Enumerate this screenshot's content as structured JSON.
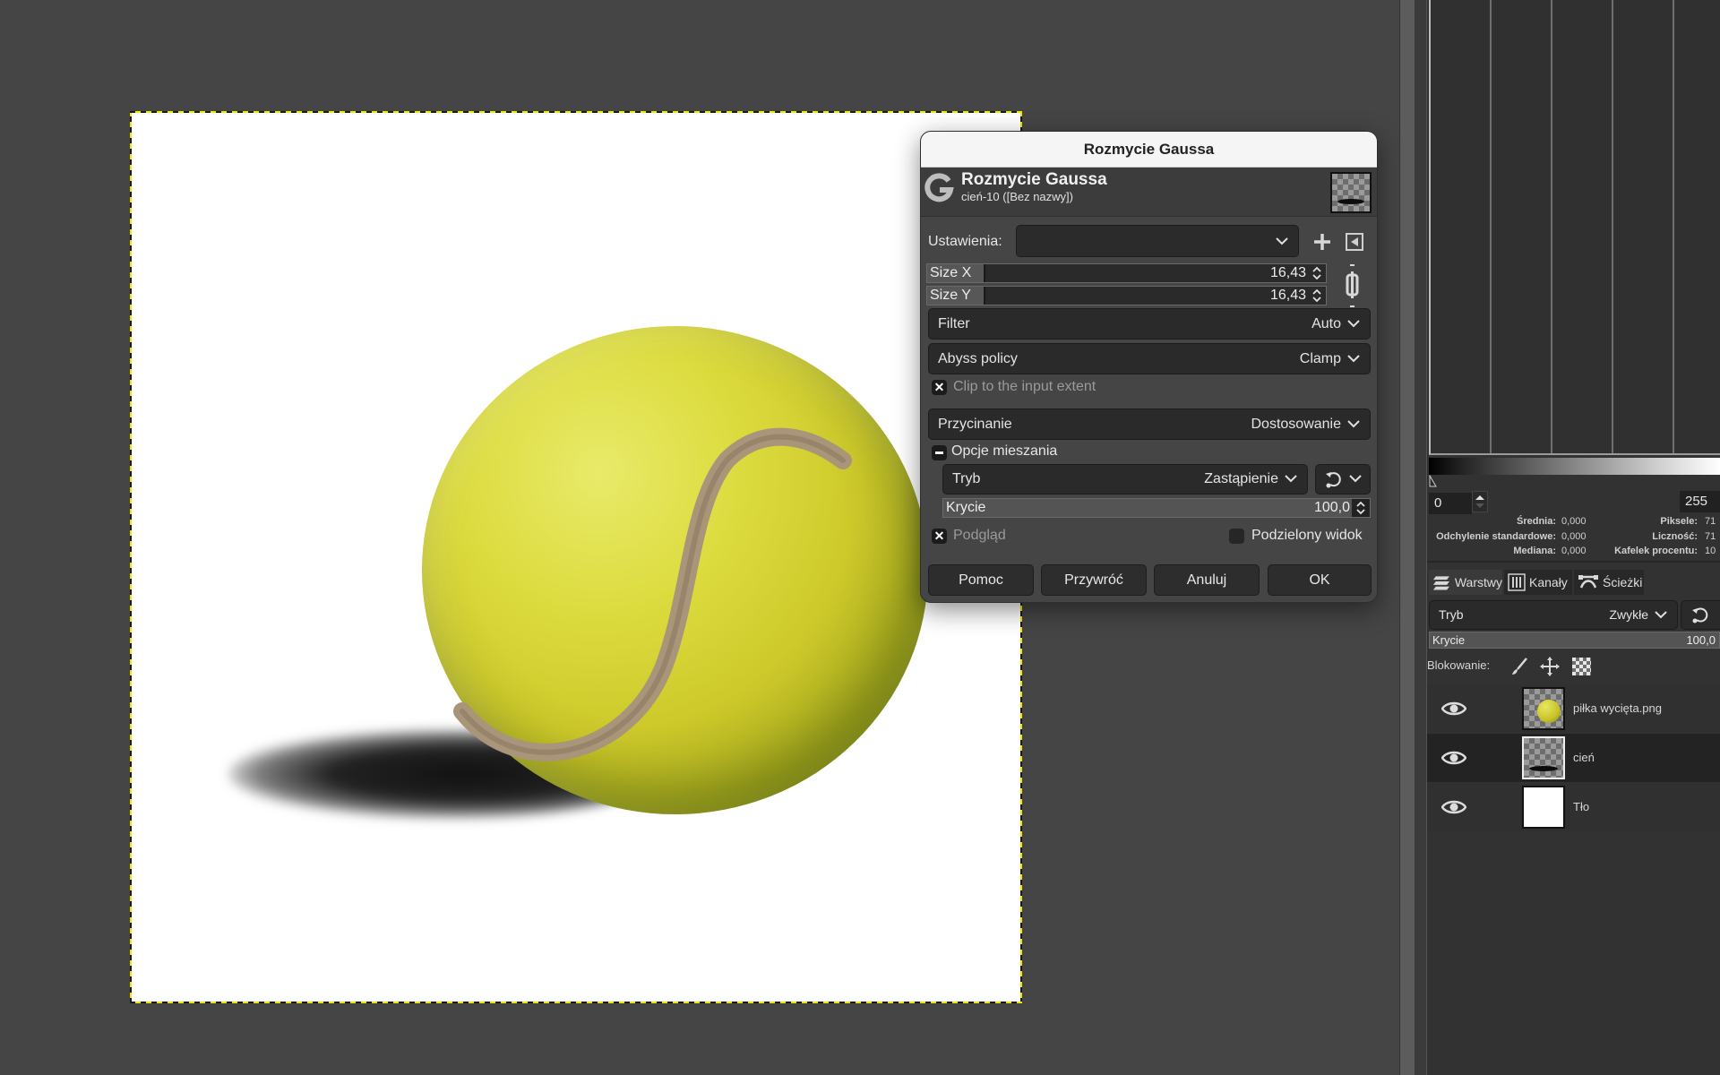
{
  "dialog": {
    "window_title": "Rozmycie Gaussa",
    "header_title": "Rozmycie Gaussa",
    "header_subtitle": "cień-10 ([Bez nazwy])",
    "presets_label": "Ustawienia:",
    "presets_value": "",
    "size_x": {
      "label": "Size X",
      "value": "16,43"
    },
    "size_y": {
      "label": "Size Y",
      "value": "16,43"
    },
    "filter": {
      "label": "Filter",
      "value": "Auto"
    },
    "abyss_policy": {
      "label": "Abyss policy",
      "value": "Clamp"
    },
    "clip_extent": {
      "label": "Clip to the input extent",
      "checked": true
    },
    "clipping": {
      "label": "Przycinanie",
      "value": "Dostosowanie"
    },
    "blending_section": {
      "label": "Opcje mieszania",
      "expanded": true
    },
    "mode": {
      "label": "Tryb",
      "value": "Zastąpienie"
    },
    "opacity": {
      "label": "Krycie",
      "value": "100,0"
    },
    "preview": {
      "label": "Podgląd",
      "checked": true
    },
    "split_view": {
      "label": "Podzielony widok",
      "checked": false
    },
    "buttons": {
      "help": "Pomoc",
      "reset": "Przywróć",
      "cancel": "Anuluj",
      "ok": "OK"
    }
  },
  "histogram": {
    "range_min": "0",
    "range_max": "255",
    "stats": {
      "mean_label": "Średnia:",
      "mean_value": "0,000",
      "stddev_label": "Odchylenie standardowe:",
      "stddev_value": "0,000",
      "median_label": "Mediana:",
      "median_value": "0,000",
      "pixels_label": "Piksele:",
      "pixels_value": "71",
      "count_label": "Liczność:",
      "count_value": "71",
      "percentile_label": "Kafelek procentu:",
      "percentile_value": "10"
    }
  },
  "dock_tabs": [
    {
      "label": "Warstwy",
      "icon": "layers-icon",
      "active": true
    },
    {
      "label": "Kanały",
      "icon": "channels-icon",
      "active": false
    },
    {
      "label": "Ścieżki",
      "icon": "paths-icon",
      "active": false
    }
  ],
  "layers_panel": {
    "mode_label": "Tryb",
    "mode_value": "Zwykłe",
    "opacity_label": "Krycie",
    "opacity_value": "100,0",
    "lock_label": "Blokowanie:",
    "layers": [
      {
        "name": "piłka wycięta.png",
        "visible": true,
        "selected": false,
        "thumb": "ball"
      },
      {
        "name": "cień",
        "visible": true,
        "selected": true,
        "thumb": "shadow"
      },
      {
        "name": "Tło",
        "visible": true,
        "selected": false,
        "thumb": "white"
      }
    ]
  },
  "colors": {
    "selection_dash": "#f3e600",
    "ball_yellow": "#d6d43a",
    "panel_bg": "#323232",
    "dialog_bg": "#454545"
  }
}
